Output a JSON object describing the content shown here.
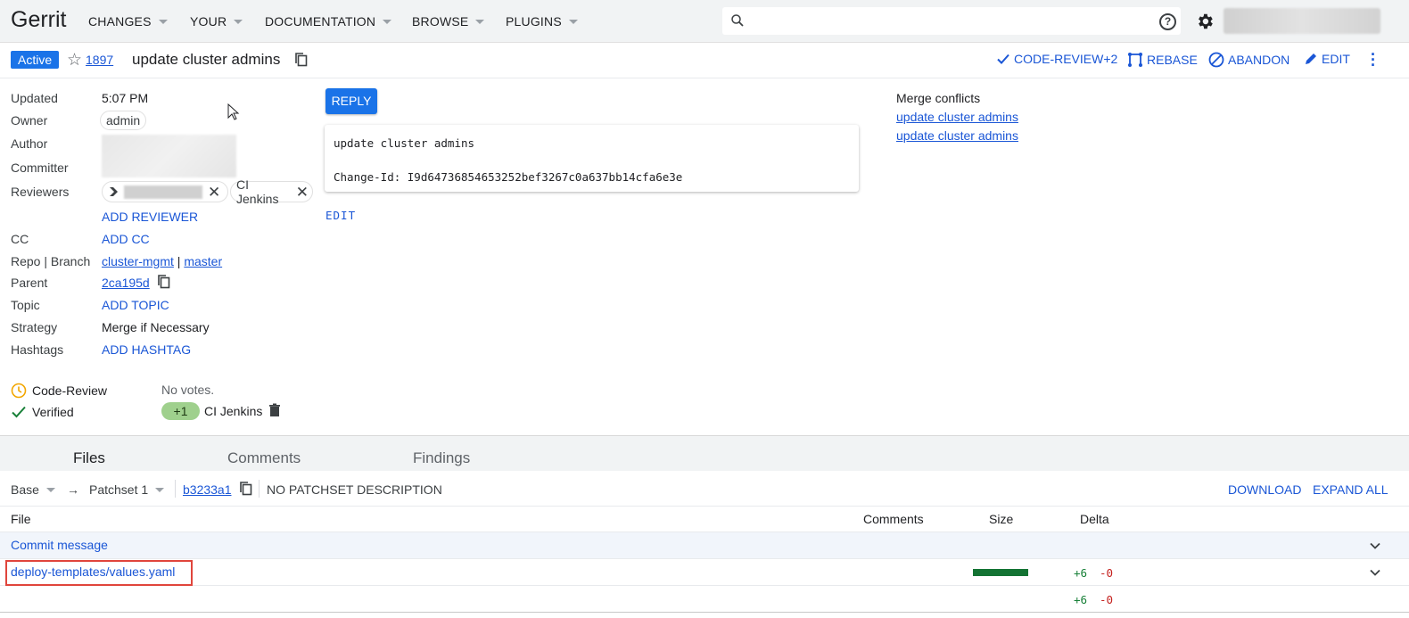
{
  "header": {
    "logo": "Gerrit",
    "nav": [
      {
        "label": "CHANGES"
      },
      {
        "label": "YOUR"
      },
      {
        "label": "DOCUMENTATION"
      },
      {
        "label": "BROWSE"
      },
      {
        "label": "PLUGINS"
      }
    ],
    "search_placeholder": "",
    "help_glyph": "?"
  },
  "change": {
    "status": "Active",
    "number": "1897",
    "subject": "update cluster admins",
    "actions": {
      "code_review": "CODE-REVIEW+2",
      "rebase": "REBASE",
      "abandon": "ABANDON",
      "edit": "EDIT"
    }
  },
  "metadata": {
    "labels": {
      "updated": "Updated",
      "owner": "Owner",
      "author": "Author",
      "committer": "Committer",
      "reviewers": "Reviewers",
      "cc": "CC",
      "repo_branch": "Repo | Branch",
      "parent": "Parent",
      "topic": "Topic",
      "strategy": "Strategy",
      "hashtags": "Hashtags"
    },
    "updated": "5:07 PM",
    "owner": "admin",
    "reviewer_2": "CI Jenkins",
    "add_reviewer": "ADD REVIEWER",
    "add_cc": "ADD CC",
    "repo": "cluster-mgmt",
    "branch_sep": "|",
    "branch": "master",
    "parent": "2ca195d",
    "add_topic": "ADD TOPIC",
    "strategy": "Merge if Necessary",
    "add_hashtag": "ADD HASHTAG"
  },
  "reply_label": "REPLY",
  "commit_message": "update cluster admins\n\nChange-Id: I9d64736854653252bef3267c0a637bb14cfa6e3e",
  "edit_commit_label": "EDIT",
  "merge_conflicts": {
    "title": "Merge conflicts",
    "items": [
      "update cluster admins",
      "update cluster admins"
    ]
  },
  "labels_votes": {
    "code_review": "Code-Review",
    "code_review_votes": "No votes.",
    "verified": "Verified",
    "verified_vote": "+1",
    "verified_account": "CI Jenkins"
  },
  "tabs": [
    "Files",
    "Comments",
    "Findings"
  ],
  "patchset_bar": {
    "base": "Base",
    "arrow": "→",
    "patchset": "Patchset 1",
    "commit": "b3233a1",
    "description": "NO PATCHSET DESCRIPTION",
    "download": "DOWNLOAD",
    "expand_all": "EXPAND ALL"
  },
  "file_list": {
    "columns": {
      "file": "File",
      "comments": "Comments",
      "size": "Size",
      "delta": "Delta"
    },
    "rows": [
      {
        "name": "Commit message"
      },
      {
        "name": "deploy-templates/values.yaml",
        "added": "+6",
        "removed": "-0"
      }
    ],
    "total": {
      "added": "+6",
      "removed": "-0"
    }
  },
  "colors": {
    "accent": "#1a73e8",
    "link": "#1a56d6",
    "vote_positive": "#9fd08d",
    "size_bar": "#137333",
    "highlight": "#e0453c"
  }
}
